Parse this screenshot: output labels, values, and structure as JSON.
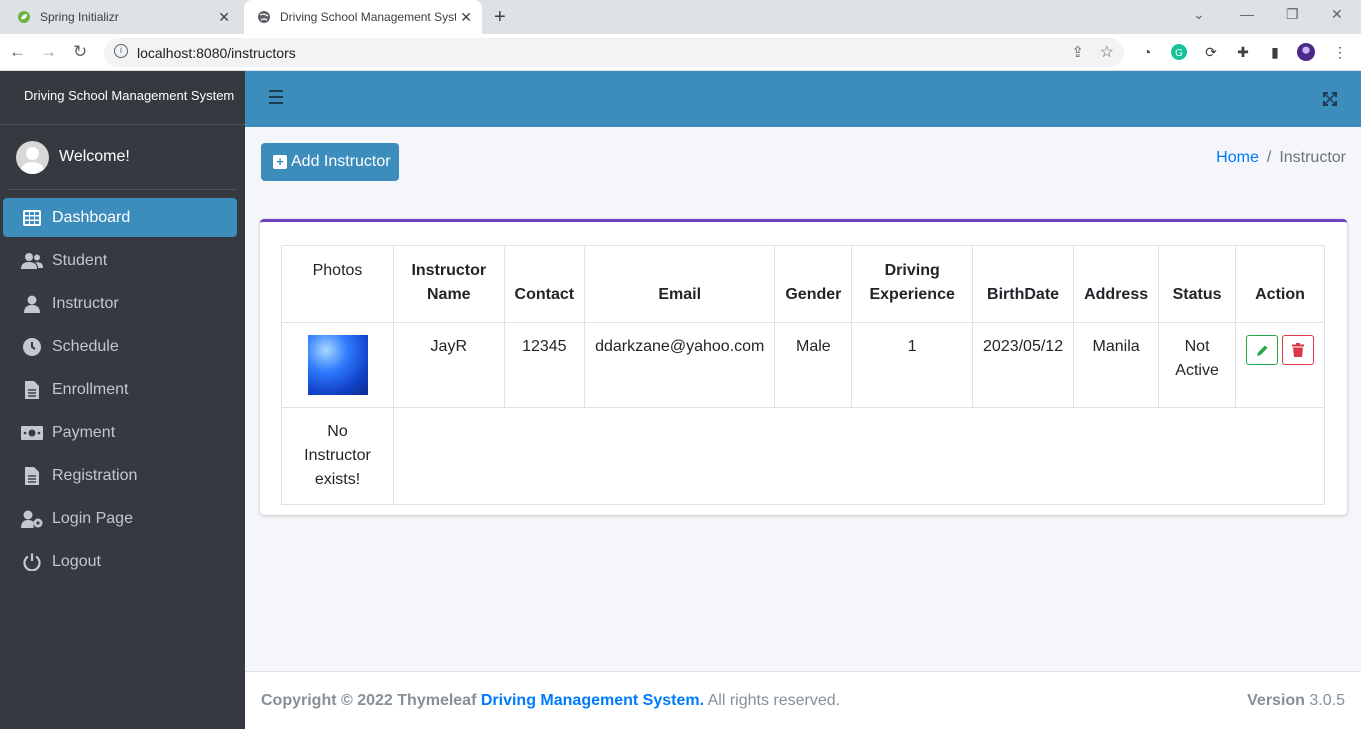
{
  "browser": {
    "tabs": [
      {
        "title": "Spring Initializr",
        "icon": "spring-leaf-icon",
        "active": false
      },
      {
        "title": "Driving School Management Syst",
        "icon": "globe-icon",
        "active": true
      }
    ],
    "url": "localhost:8080/instructors"
  },
  "sidebar": {
    "brand": "Driving School Management System",
    "welcome": "Welcome!",
    "items": [
      {
        "label": "Dashboard",
        "icon": "grid-icon",
        "active": true
      },
      {
        "label": "Student",
        "icon": "users-icon"
      },
      {
        "label": "Instructor",
        "icon": "user-icon"
      },
      {
        "label": "Schedule",
        "icon": "clock-icon"
      },
      {
        "label": "Enrollment",
        "icon": "document-icon"
      },
      {
        "label": "Payment",
        "icon": "money-icon"
      },
      {
        "label": "Registration",
        "icon": "document-icon"
      },
      {
        "label": "Login Page",
        "icon": "user-cog-icon"
      },
      {
        "label": "Logout",
        "icon": "power-icon"
      }
    ]
  },
  "page": {
    "add_button": "Add Instructor",
    "breadcrumb": {
      "home": "Home",
      "separator": "/",
      "current": "Instructor"
    }
  },
  "table": {
    "headers": [
      "Photos",
      "Instructor Name",
      "Contact",
      "Email",
      "Gender",
      "Driving Experience",
      "BirthDate",
      "Address",
      "Status",
      "Action"
    ],
    "rows": [
      {
        "name": "JayR",
        "contact": "12345",
        "email": "ddarkzane@yahoo.com",
        "gender": "Male",
        "experience": "1",
        "birthdate": "2023/05/12",
        "address": "Manila",
        "status": "Not Active"
      }
    ],
    "empty_message": "No Instructor exists!"
  },
  "footer": {
    "copyright": "Copyright © 2022 Thymeleaf",
    "link": "Driving Management System.",
    "rights": "All rights reserved.",
    "version_label": "Version",
    "version": "3.0.5"
  },
  "colors": {
    "sidebar_bg": "#343a40",
    "primary": "#3c8dbc",
    "card_accent": "#6f42c1",
    "edit": "#28a745",
    "delete": "#dc3545"
  }
}
